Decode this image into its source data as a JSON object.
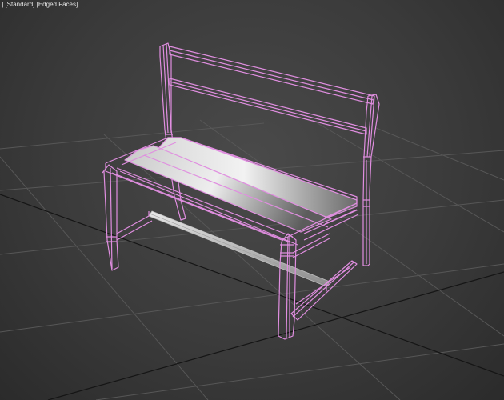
{
  "viewport": {
    "label_prefix": "] ",
    "shading_mode": "[Standard]",
    "display_mode": "[Edged Faces]"
  },
  "colors": {
    "background": "#3b3b3b",
    "grid_line": "#555555",
    "grid_axis": "#121212",
    "wireframe_selected": "#e08ee0",
    "seat_slat_light": "#f2f2f2",
    "seat_slat_dark": "#5a5a5a",
    "stretcher": "#cfcfcf"
  },
  "scene": {
    "object": "bench-model",
    "selected": true,
    "parts": [
      "backrest",
      "seat-slats",
      "front-legs",
      "rear-legs",
      "stretcher"
    ]
  }
}
